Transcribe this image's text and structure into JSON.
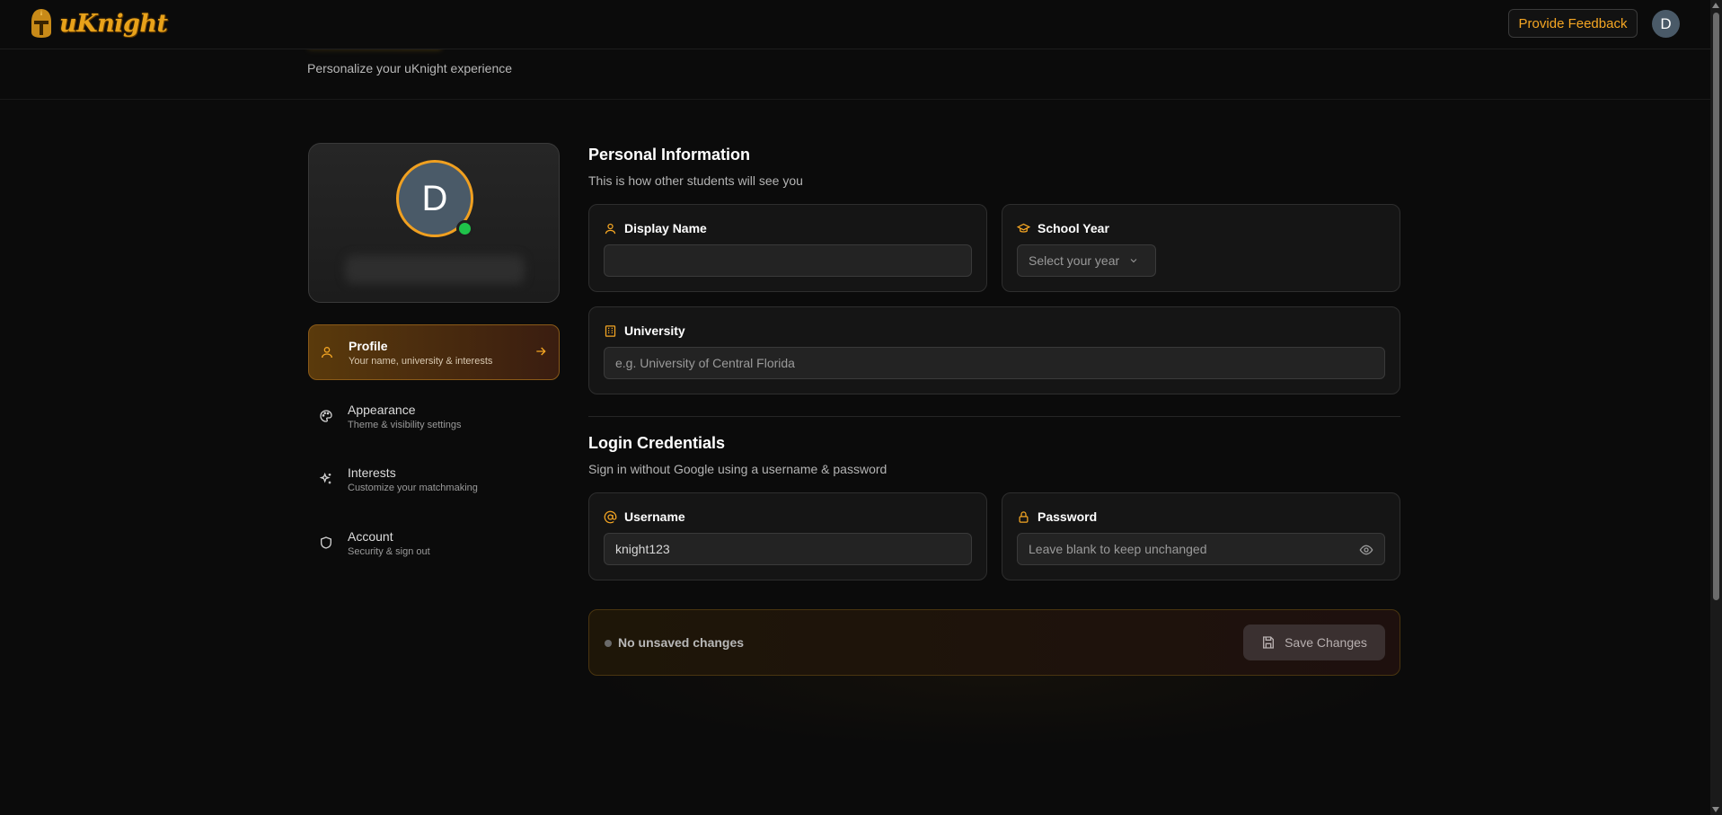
{
  "nav": {
    "logo_text": "uKnight",
    "feedback_label": "Provide Feedback",
    "avatar_initial": "D"
  },
  "header": {
    "subtitle": "Personalize your uKnight experience"
  },
  "profile_card": {
    "avatar_initial": "D",
    "online_color": "#1fc24a"
  },
  "sidebar": {
    "items": [
      {
        "title": "Profile",
        "subtitle": "Your name, university & interests",
        "icon": "user-icon",
        "active": true
      },
      {
        "title": "Appearance",
        "subtitle": "Theme & visibility settings",
        "icon": "palette-icon",
        "active": false
      },
      {
        "title": "Interests",
        "subtitle": "Customize your matchmaking",
        "icon": "sparkles-icon",
        "active": false
      },
      {
        "title": "Account",
        "subtitle": "Security & sign out",
        "icon": "shield-icon",
        "active": false
      }
    ]
  },
  "personal": {
    "title": "Personal Information",
    "subtitle": "This is how other students will see you",
    "display_name_label": "Display Name",
    "display_name_value": "",
    "school_year_label": "School Year",
    "school_year_placeholder": "Select your year",
    "university_label": "University",
    "university_placeholder": "e.g. University of Central Florida"
  },
  "credentials": {
    "title": "Login Credentials",
    "subtitle": "Sign in without Google using a username & password",
    "username_label": "Username",
    "username_value": "knight123",
    "password_label": "Password",
    "password_placeholder": "Leave blank to keep unchanged"
  },
  "save_bar": {
    "status": "No unsaved changes",
    "save_label": "Save Changes"
  },
  "colors": {
    "accent": "#f5a623",
    "background": "#0b0b0b"
  }
}
